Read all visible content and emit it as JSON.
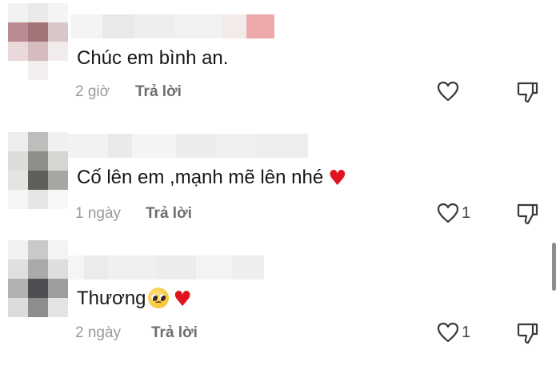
{
  "comments": [
    {
      "text": "Chúc em bình an.",
      "time": "2 giờ",
      "reply_label": "Trả lời",
      "like_count": ""
    },
    {
      "text": "Cố lên em ,mạnh mẽ lên nhé",
      "time": "1 ngày",
      "reply_label": "Trả lời",
      "like_count": "1"
    },
    {
      "text": "Thương",
      "time": "2 ngày",
      "reply_label": "Trả lời",
      "like_count": "1"
    }
  ],
  "icons": {
    "like": "heart-outline-icon",
    "dislike": "thumbs-down-outline-icon",
    "emoji_heart": "red-heart-emoji",
    "emoji_pleading": "pleading-face-emoji"
  },
  "colors": {
    "text": "#161616",
    "meta": "#9a9a9a",
    "reply": "#6e6e6e",
    "heart_emoji": "#e0141e",
    "scrollbar": "#8e8e8e"
  }
}
